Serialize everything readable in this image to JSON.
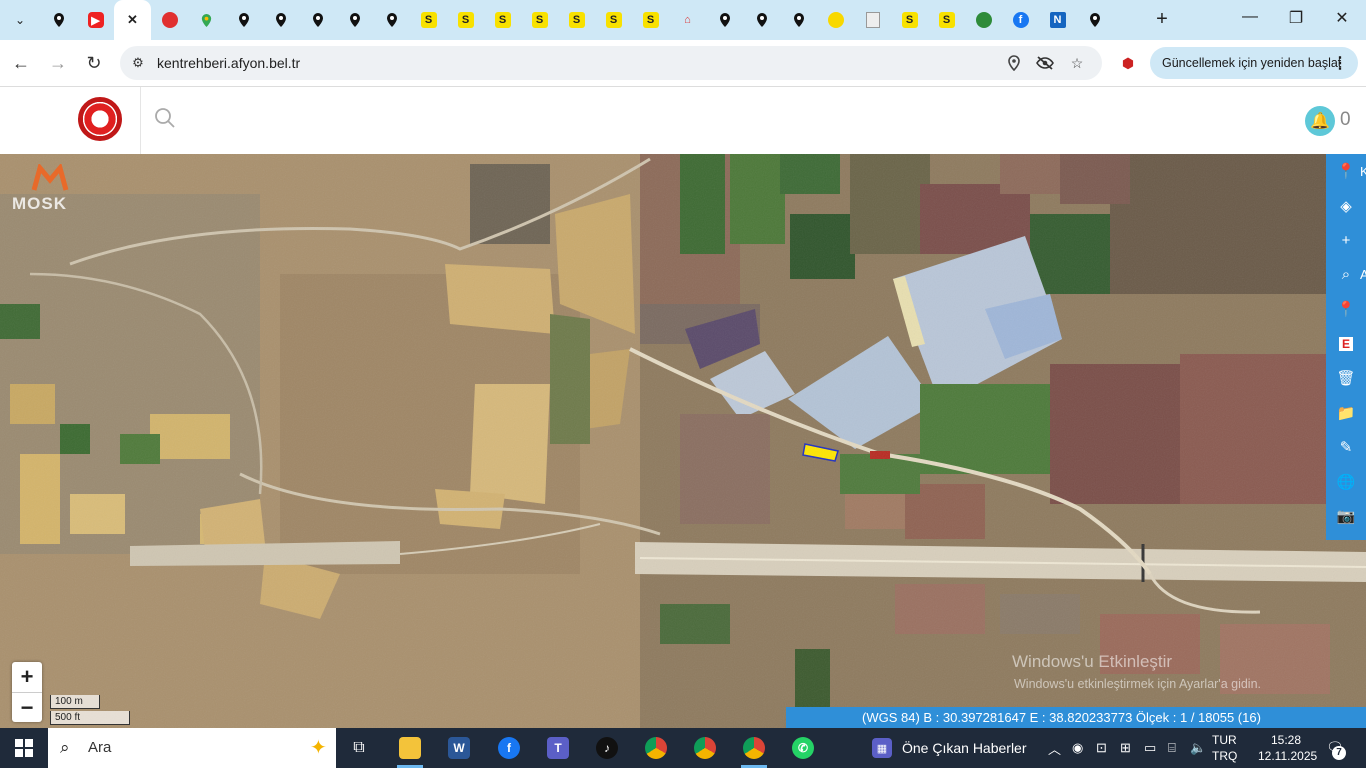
{
  "browser": {
    "tabs": [
      {
        "icon": "map-pin-icon"
      },
      {
        "icon": "youtube-icon"
      },
      {
        "icon": "close-tab-icon",
        "active": true
      },
      {
        "icon": "red-badge-icon"
      },
      {
        "icon": "google-maps-icon"
      },
      {
        "icon": "map-pin-icon"
      },
      {
        "icon": "map-pin-icon"
      },
      {
        "icon": "map-pin-icon"
      },
      {
        "icon": "map-pin-icon"
      },
      {
        "icon": "map-pin-icon"
      },
      {
        "icon": "s-icon",
        "label": "S"
      },
      {
        "icon": "s-icon",
        "label": "S"
      },
      {
        "icon": "s-icon",
        "label": "S"
      },
      {
        "icon": "s-icon",
        "label": "S"
      },
      {
        "icon": "s-icon",
        "label": "S"
      },
      {
        "icon": "s-icon",
        "label": "S"
      },
      {
        "icon": "s-icon",
        "label": "S"
      },
      {
        "icon": "home-icon"
      },
      {
        "icon": "map-pin-icon"
      },
      {
        "icon": "map-pin-icon"
      },
      {
        "icon": "map-pin-icon"
      },
      {
        "icon": "yellow-circle-icon"
      },
      {
        "icon": "document-icon"
      },
      {
        "icon": "s-icon",
        "label": "S"
      },
      {
        "icon": "s-icon",
        "label": "S"
      },
      {
        "icon": "green-circle-icon"
      },
      {
        "icon": "facebook-icon",
        "label": "f"
      },
      {
        "icon": "n-app-icon"
      },
      {
        "icon": "map-pin-icon"
      }
    ],
    "url": "kentrehberi.afyon.bel.tr",
    "update_label": "Güncellemek için yeniden başlat"
  },
  "site": {
    "notification_count": "0"
  },
  "map": {
    "watermark": "MOSK",
    "scale_metric": "100 m",
    "scale_imperial": "500 ft",
    "zoom_in": "+",
    "zoom_out": "−",
    "toolbar": [
      {
        "name": "location-pin-icon",
        "glyph": "📍",
        "label": "K"
      },
      {
        "name": "layers-icon",
        "glyph": "◈"
      },
      {
        "name": "plus-icon",
        "glyph": "+"
      },
      {
        "name": "search-icon",
        "glyph": "⌕",
        "label": "A"
      },
      {
        "name": "location-icon",
        "glyph": "📍"
      },
      {
        "name": "e-icon",
        "glyph": "E"
      },
      {
        "name": "trash-icon",
        "glyph": "🗑"
      },
      {
        "name": "folder-icon",
        "glyph": "📁"
      },
      {
        "name": "pencil-icon",
        "glyph": "✎"
      },
      {
        "name": "globe-icon",
        "glyph": "🌐"
      },
      {
        "name": "camera-icon",
        "glyph": "📷"
      }
    ],
    "coordinates": "(WGS 84) B : 30.397281647 E : 38.820233773 Ölçek : 1 / 18055 (16)",
    "windows_activation_title": "Windows'u Etkinleştir",
    "windows_activation_sub": "Windows'u etkinleştirmek için Ayarlar'a gidin."
  },
  "taskbar": {
    "search_placeholder": "Ara",
    "news": "Öne Çıkan Haberler",
    "lang_top": "TUR",
    "lang_bottom": "TRQ",
    "time": "15:28",
    "date": "12.11.2025",
    "notifications": "7"
  },
  "colors": {
    "tab_strip": "#cfe8f6",
    "map_toolbar": "#2f8fd8",
    "taskbar": "#1f2a3a"
  }
}
